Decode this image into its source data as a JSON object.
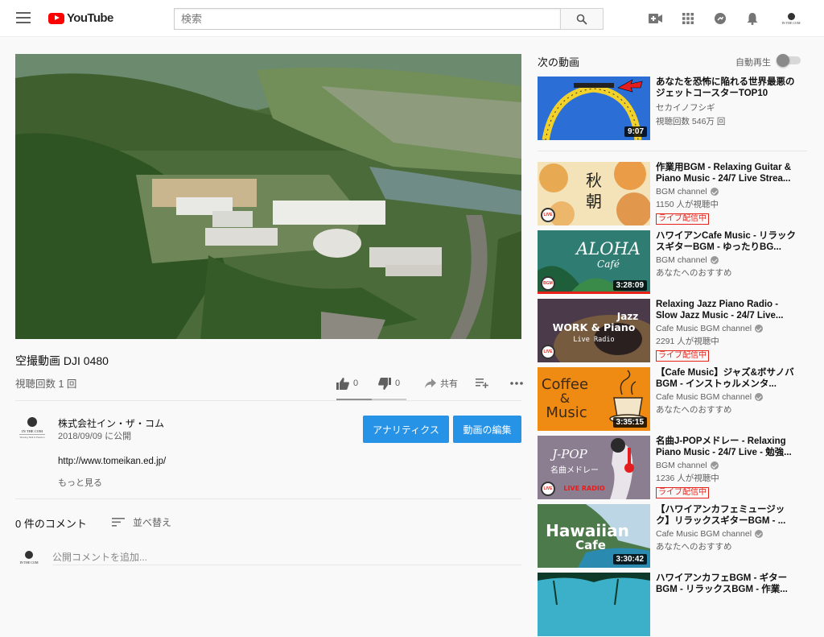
{
  "masthead": {
    "logo_text": "YouTube",
    "search_placeholder": "検索",
    "icons": [
      "menu-icon",
      "video-upload-icon",
      "apps-grid-icon",
      "messages-icon",
      "notifications-bell-icon",
      "account-avatar"
    ]
  },
  "video": {
    "title": "空撮動画 DJI 0480",
    "views": "視聴回数 1 回",
    "likes": "0",
    "dislikes": "0",
    "like_ratio": 0.5,
    "share_label": "共有",
    "owner": {
      "name": "株式会社イン・ザ・コム",
      "published": "2018/09/09 に公開",
      "avatar_text": "IN THE COM",
      "avatar_tagline": "Sharing Skill & Passion"
    },
    "buttons": {
      "analytics": "アナリティクス",
      "edit": "動画の編集"
    },
    "description": "http://www.tomeikan.ed.jp/",
    "show_more": "もっと見る"
  },
  "comments": {
    "count_label": "0 件のコメント",
    "sort_label": "並べ替え",
    "input_placeholder": "公開コメントを追加..."
  },
  "sidebar": {
    "up_next_label": "次の動画",
    "autoplay_label": "自動再生",
    "autoplay_on": false,
    "items": [
      {
        "title": "あなたを恐怖に陥れる世界最悪のジェットコースターTOP10",
        "channel": "セカイノフシギ",
        "verified": false,
        "meta": "視聴回数 546万 回",
        "duration": "9:07",
        "live": false
      },
      {
        "title": "作業用BGM - Relaxing Guitar & Piano Music - 24/7 Live Strea...",
        "channel": "BGM channel",
        "verified": true,
        "meta": "1150 人が視聴中",
        "live_badge": "ライブ配信中",
        "live": true,
        "thumb_text": [
          "秋",
          "朝"
        ]
      },
      {
        "title": "ハワイアンCafe Music - リラックスギターBGM - ゆったりBG...",
        "channel": "BGM channel",
        "verified": true,
        "meta": "あなたへのおすすめ",
        "duration": "3:28:09",
        "live": false,
        "thumb_text": [
          "ALOHA",
          "Café"
        ]
      },
      {
        "title": "Relaxing Jazz Piano Radio - Slow Jazz Music - 24/7 Live...",
        "channel": "Cafe Music BGM channel",
        "verified": true,
        "meta": "2291 人が視聴中",
        "live_badge": "ライブ配信中",
        "live": true,
        "thumb_text": [
          "Jazz",
          "WORK & Piano",
          "Live Radio"
        ]
      },
      {
        "title": "【Cafe Music】ジャズ&ボサノバBGM - インストゥルメンタ...",
        "channel": "Cafe Music BGM channel",
        "verified": true,
        "meta": "あなたへのおすすめ",
        "duration": "3:35:15",
        "live": false,
        "thumb_text": [
          "Coffee",
          "&",
          "Music"
        ]
      },
      {
        "title": "名曲J-POPメドレー - Relaxing Piano Music - 24/7 Live - 勉強...",
        "channel": "BGM channel",
        "verified": true,
        "meta": "1236 人が視聴中",
        "live_badge": "ライブ配信中",
        "live": true,
        "thumb_text": [
          "J-POP",
          "名曲メドレー",
          "LIVE RADIO"
        ]
      },
      {
        "title": "【ハワイアンカフェミュージック】リラックスギターBGM - ...",
        "channel": "Cafe Music BGM channel",
        "verified": true,
        "meta": "あなたへのおすすめ",
        "duration": "3:30:42",
        "live": false,
        "thumb_text": [
          "Hawaiian",
          "Cafe"
        ]
      },
      {
        "title": "ハワイアンカフェBGM - ギターBGM - リラックスBGM - 作業...",
        "channel": "",
        "verified": false,
        "meta": "",
        "live": false
      }
    ]
  },
  "colors": {
    "brand_red": "#ff0000",
    "button_blue": "#2793e6",
    "live_red": "#e62117"
  }
}
